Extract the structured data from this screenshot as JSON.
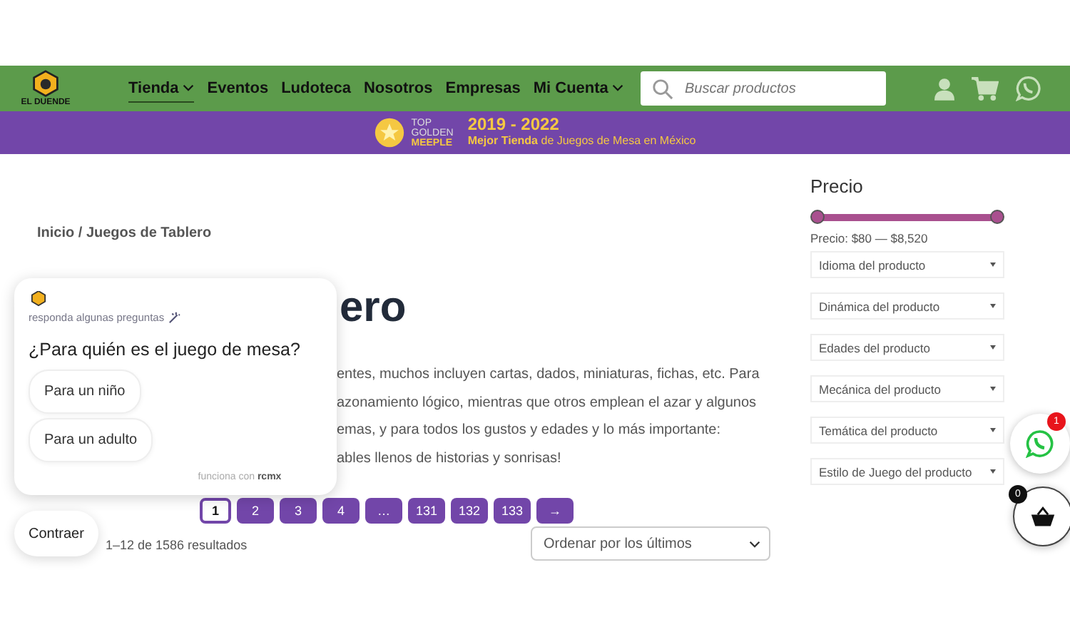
{
  "nav": {
    "logo_text": "EL DUENDE",
    "items": [
      {
        "label": "Tienda",
        "selected": true,
        "dropdown": true
      },
      {
        "label": "Eventos",
        "selected": false,
        "dropdown": false
      },
      {
        "label": "Ludoteca",
        "selected": false,
        "dropdown": false
      },
      {
        "label": "Nosotros",
        "selected": false,
        "dropdown": false
      },
      {
        "label": "Empresas",
        "selected": false,
        "dropdown": false
      },
      {
        "label": "Mi Cuenta",
        "selected": false,
        "dropdown": true
      }
    ],
    "search": {
      "placeholder": "Buscar productos"
    }
  },
  "banner": {
    "award_lines": [
      "TOP",
      "GOLDEN",
      "MEEPLE"
    ],
    "years": "2019 - 2022",
    "tagline": "**Mejor Tienda** de Juegos de Mesa en México"
  },
  "breadcrumb": "Inicio / Juegos de Tablero",
  "title": "ero",
  "description_lines": [
    "entes, muchos incluyen cartas, dados, miniaturas, fichas, etc. Para",
    "azonamiento lógico, mientras que otros emplean el azar y algunos",
    "emas, y para todos los gustos y edades y lo más importante:",
    "ables llenos de historias y sonrisas!"
  ],
  "pagination": [
    {
      "label": "1",
      "selected": true
    },
    {
      "label": "2",
      "selected": false
    },
    {
      "label": "3",
      "selected": false
    },
    {
      "label": "4",
      "selected": false
    },
    {
      "label": "…",
      "selected": false
    },
    {
      "label": "131",
      "selected": false
    },
    {
      "label": "132",
      "selected": false
    },
    {
      "label": "133",
      "selected": false
    },
    {
      "label": "→",
      "selected": false
    }
  ],
  "results_count": "1–12 de 1586 resultados",
  "sort": {
    "value": "Ordenar por los últimos"
  },
  "sidebar": {
    "price_heading": "Precio",
    "price_range": "Precio: $80 — $8,520",
    "filters": [
      "Idioma del producto",
      "Dinámica del producto",
      "Edades del producto",
      "Mecánica del producto",
      "Temática del producto",
      "Estilo de Juego del producto"
    ]
  },
  "quiz": {
    "subtitle": "responda algunas preguntas",
    "question": "¿Para quién es el juego de mesa?",
    "options": [
      "Para un niño",
      "Para un adulto"
    ],
    "footer_prefix": "funciona con",
    "footer_brand": "rcmx",
    "collapse": "Contraer"
  },
  "whatsapp_badge": "1",
  "cart_badge": "0"
}
